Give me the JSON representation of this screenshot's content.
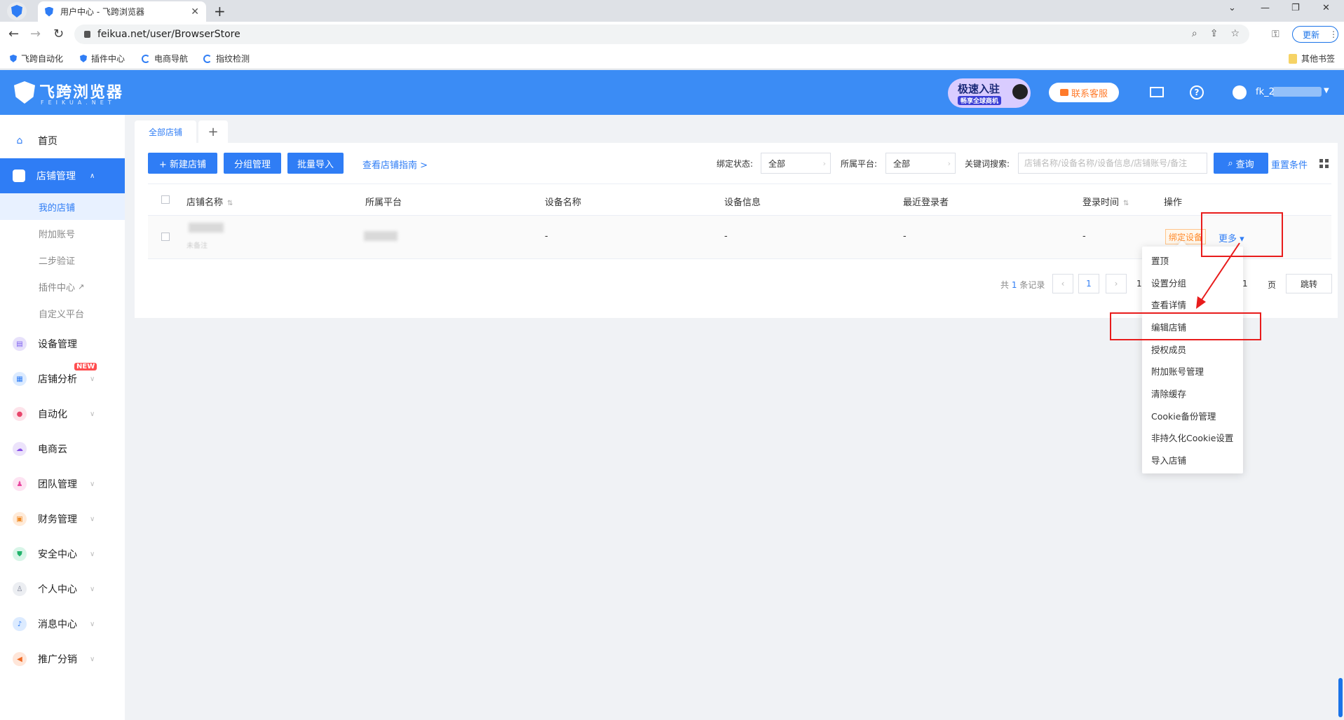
{
  "browser": {
    "tab_title": "用户中心 - 飞跨浏览器",
    "tab_close": "✕",
    "new_tab": "+",
    "url": "feikua.net/user/BrowserStore",
    "update_label": "更新",
    "bookmarks": [
      "飞跨自动化",
      "插件中心",
      "电商导航",
      "指纹检测"
    ],
    "other_bookmarks": "其他书签"
  },
  "header": {
    "logo_text": "飞跨浏览器",
    "logo_sub": "FEIKUA.NET",
    "promo_line1": "极速入驻",
    "promo_line2": "畅享全球商机",
    "support_label": "联系客服",
    "user_name": "fk_2"
  },
  "sidebar": {
    "items": [
      {
        "label": "首页"
      },
      {
        "label": "店铺管理"
      },
      {
        "label": "设备管理"
      },
      {
        "label": "店铺分析"
      },
      {
        "label": "自动化"
      },
      {
        "label": "电商云"
      },
      {
        "label": "团队管理"
      },
      {
        "label": "财务管理"
      },
      {
        "label": "安全中心"
      },
      {
        "label": "个人中心"
      },
      {
        "label": "消息中心"
      },
      {
        "label": "推广分销"
      }
    ],
    "submenu": [
      {
        "label": "我的店铺"
      },
      {
        "label": "附加账号"
      },
      {
        "label": "二步验证"
      },
      {
        "label": "插件中心"
      },
      {
        "label": "自定义平台"
      }
    ],
    "new_badge": "NEW"
  },
  "main": {
    "tab_label": "全部店铺",
    "add_tab": "+",
    "buttons": {
      "new_store": "+ 新建店铺",
      "group_manage": "分组管理",
      "batch_import": "批量导入"
    },
    "guide_link": "查看店铺指南 >",
    "filters": {
      "bind_status_label": "绑定状态:",
      "bind_status_value": "全部",
      "platform_label": "所属平台:",
      "platform_value": "全部",
      "keyword_label": "关键词搜索:",
      "keyword_placeholder": "店铺名称/设备名称/设备信息/店铺账号/备注"
    },
    "query_label": "查询",
    "reset_label": "重置条件",
    "table": {
      "columns": [
        "店铺名称",
        "所属平台",
        "设备名称",
        "设备信息",
        "最近登录者",
        "登录时间",
        "操作"
      ],
      "rows": [
        {
          "device_name": "-",
          "device_info": "-",
          "last_login_user": "-",
          "login_time": "-",
          "remark": "未备注"
        }
      ],
      "bind_device_label": "绑定设备",
      "more_label": "更多 ▾"
    },
    "pagination": {
      "total_prefix": "共",
      "total": "1",
      "total_suffix": "条记录",
      "prev": "‹",
      "current": "1",
      "next": "›",
      "goto_partial": "1",
      "goto_value": "1",
      "page_suffix": "页",
      "jump_label": "跳转"
    }
  },
  "dropdown": {
    "items": [
      "置顶",
      "设置分组",
      "查看详情",
      "编辑店铺",
      "授权成员",
      "附加账号管理",
      "清除缓存",
      "Cookie备份管理",
      "非持久化Cookie设置",
      "导入店铺"
    ]
  },
  "colors": {
    "accent": "#2f7df5",
    "header": "#3b8cf5",
    "annotation": "#e81c1c",
    "warning": "#ff8a2a"
  }
}
